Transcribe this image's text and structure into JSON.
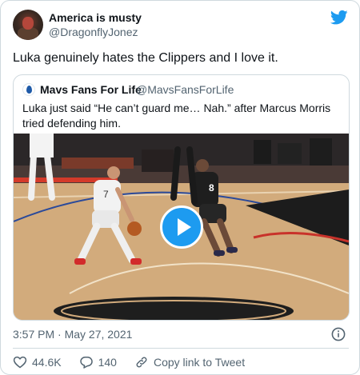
{
  "author": {
    "display_name": "America is musty",
    "handle": "@DragonflyJonez"
  },
  "tweet": {
    "text": "Luka genuinely hates the Clippers and I love it."
  },
  "quoted_tweet": {
    "display_name": "Mavs Fans For Life",
    "handle": "@MavsFansForLife",
    "text": "Luka just said “He can’t guard me… Nah.” after Marcus Morris tried defending him.",
    "media": {
      "type": "video",
      "jersey_number_left": "7",
      "jersey_number_right": "8"
    }
  },
  "meta": {
    "timestamp": "3:57 PM · May 27, 2021"
  },
  "actions": {
    "likes": "44.6K",
    "replies": "140",
    "copy_link": "Copy link to Tweet"
  },
  "colors": {
    "accent": "#1d9bf0",
    "secondary_text": "#536471",
    "border": "#cfd9de"
  },
  "icons": {
    "brand": "twitter-bird-icon",
    "play": "play-icon",
    "info": "info-icon",
    "like": "heart-icon",
    "reply": "reply-bubble-icon",
    "link": "link-icon"
  }
}
